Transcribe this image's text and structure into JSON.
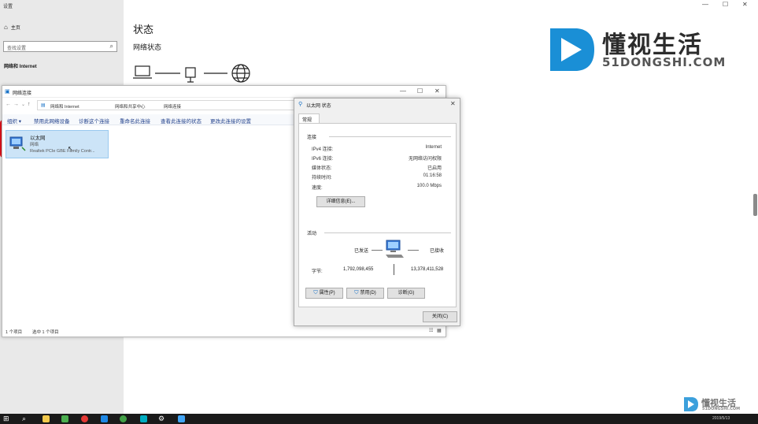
{
  "settings": {
    "window_title": "设置",
    "home_label": "主页",
    "search_placeholder": "查找设置",
    "category": "网络和 Internet",
    "page_title": "状态",
    "section_title": "网络状态"
  },
  "logo": {
    "chinese": "懂视生活",
    "domain": "51DONGSHI.COM",
    "watermark_chinese": "懂视生活",
    "watermark_domain": "51DONGSHI.COM"
  },
  "explorer": {
    "title": "网络连接",
    "breadcrumb": [
      "网络和 Internet",
      "网络和共享中心",
      "网络连接"
    ],
    "commands": [
      "组织 ▾",
      "禁用此网络设备",
      "诊断这个连接",
      "重命名此连接",
      "查看此连接的状态",
      "更改此连接的设置"
    ],
    "adapter": {
      "name": "以太网",
      "status": "网络",
      "device": "Realtek PCIe GBE Family Contr..."
    },
    "status_left": "1 个项目",
    "status_right": "选中 1 个项目"
  },
  "dialog": {
    "title": "以太网 状态",
    "tab": "常规",
    "connection_header": "连接",
    "rows": [
      {
        "label": "IPv4 连接:",
        "value": "Internet"
      },
      {
        "label": "IPv6 连接:",
        "value": "无网络访问权限"
      },
      {
        "label": "媒体状态:",
        "value": "已启用"
      },
      {
        "label": "持续时间:",
        "value": "01:16:58"
      },
      {
        "label": "速度:",
        "value": "100.0 Mbps"
      }
    ],
    "details_button": "详细信息(E)...",
    "activity_header": "活动",
    "sent_label": "已发送",
    "received_label": "已接收",
    "bytes_label": "字节:",
    "bytes_sent": "1,792,098,455",
    "bytes_received": "13,378,411,528",
    "properties_button": "属性(P)",
    "disable_button": "禁用(D)",
    "diagnose_button": "诊断(G)",
    "close_button": "关闭(C)"
  },
  "taskbar": {
    "clock": "2019/5/13"
  },
  "colors": {
    "accent_red": "#e2121b",
    "selection_blue": "#cce4f7",
    "logo_blue": "#1a8fd6",
    "taskbar": "#1a1a1a"
  }
}
